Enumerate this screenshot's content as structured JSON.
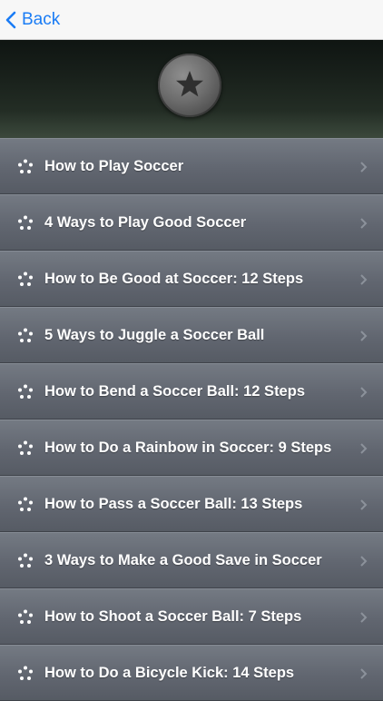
{
  "nav": {
    "back_label": "Back"
  },
  "list": {
    "items": [
      {
        "label": "How to Play Soccer"
      },
      {
        "label": "4 Ways to Play Good Soccer"
      },
      {
        "label": "How to Be Good at Soccer: 12 Steps"
      },
      {
        "label": "5 Ways to Juggle a Soccer Ball"
      },
      {
        "label": "How to Bend a Soccer Ball: 12 Steps"
      },
      {
        "label": "How to Do a Rainbow in Soccer: 9 Steps"
      },
      {
        "label": "How to Pass a Soccer Ball: 13 Steps"
      },
      {
        "label": "3 Ways to Make a Good Save in Soccer"
      },
      {
        "label": "How to Shoot a Soccer Ball: 7 Steps"
      },
      {
        "label": "How to Do a Bicycle Kick: 14 Steps"
      }
    ]
  },
  "icons": {
    "back": "chevron-left-icon",
    "badge": "star-icon",
    "bullet": "dots-bullet-icon",
    "disclosure": "chevron-right-icon"
  },
  "colors": {
    "nav_bg": "#f7f7f7",
    "accent": "#1a7cf5",
    "row_bg": "#616670",
    "row_text": "#ffffff"
  }
}
